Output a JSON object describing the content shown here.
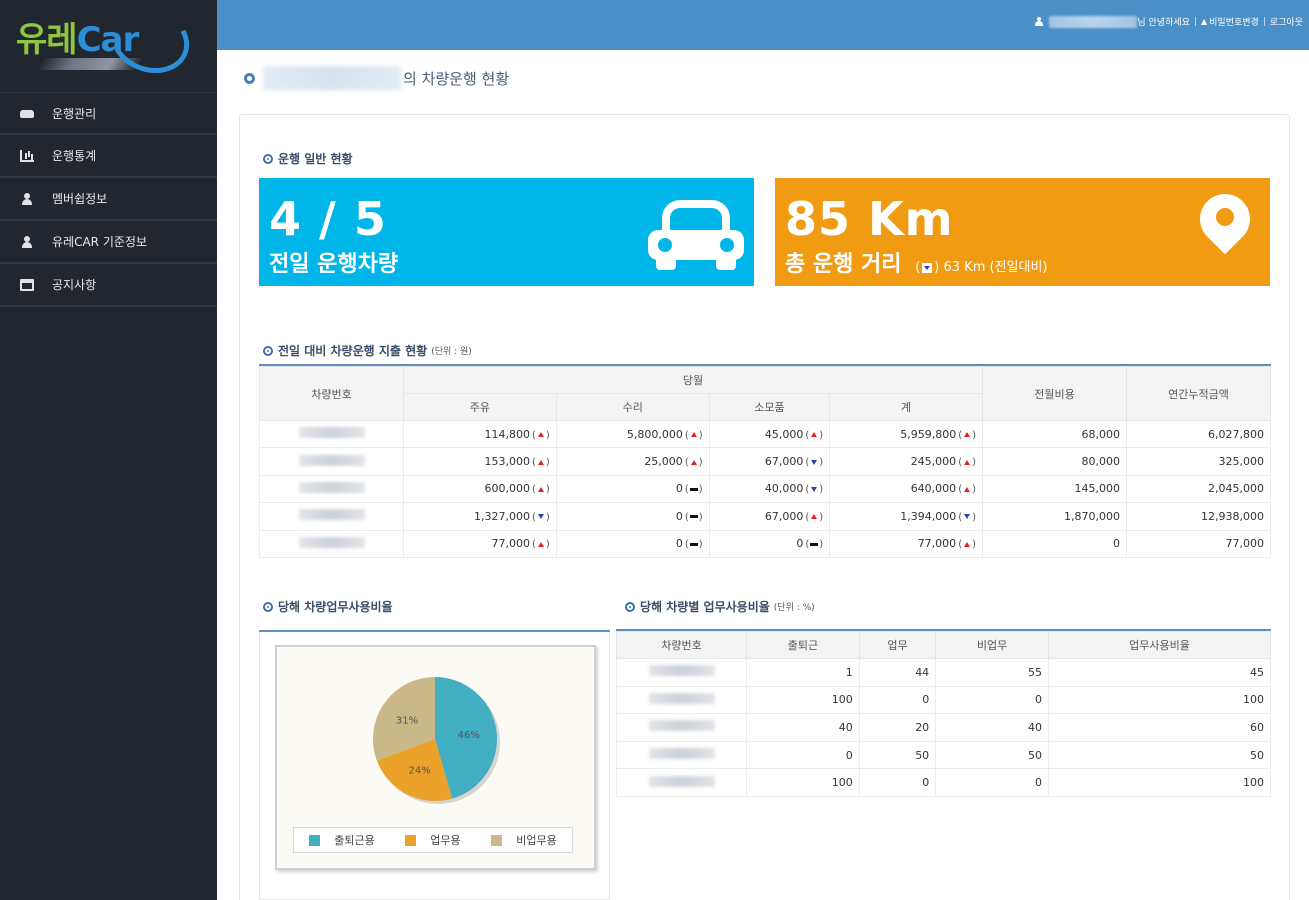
{
  "app": {
    "logo": {
      "part1": "유레",
      "part2": "Car"
    }
  },
  "sidebar": {
    "items": [
      {
        "label": "운행관리",
        "icon": "car-icon"
      },
      {
        "label": "운행통계",
        "icon": "chart-icon"
      },
      {
        "label": "멤버쉽정보",
        "icon": "user-icon"
      },
      {
        "label": "유레CAR 기준정보",
        "icon": "user-icon"
      },
      {
        "label": "공지사항",
        "icon": "calendar-icon"
      }
    ]
  },
  "topbar": {
    "greeting": "님 안녕하세요",
    "change_password": "비밀번호변경",
    "logout": "로그아웃",
    "separator": "|"
  },
  "page": {
    "title_suffix": "의 차량운행 현황"
  },
  "section_general": {
    "title": "운행 일반 현황",
    "cards": {
      "vehicles": {
        "value": "4 / 5",
        "label": "전일 운행차량",
        "color": "#00b5e8"
      },
      "distance": {
        "value": "85 Km",
        "label": "총 운행 거리",
        "delta_prefix": "(",
        "delta": "63 Km (전일대비)",
        "color": "#f19b13"
      }
    }
  },
  "section_expense": {
    "title": "전일 대비 차량운행 지출 현황",
    "unit": "(단위 : 원)",
    "headers": {
      "vehicle_no": "차량번호",
      "group_today": "당월",
      "fuel": "주유",
      "repair": "수리",
      "consumables": "소모품",
      "total": "계",
      "prev_month": "전월비용",
      "annual": "연간누적금액"
    },
    "rows": [
      {
        "fuel": "114,800",
        "fuel_t": "up",
        "repair": "5,800,000",
        "repair_t": "up",
        "cons": "45,000",
        "cons_t": "up",
        "total": "5,959,800",
        "total_t": "up",
        "prev": "68,000",
        "annual": "6,027,800"
      },
      {
        "fuel": "153,000",
        "fuel_t": "up",
        "repair": "25,000",
        "repair_t": "up",
        "cons": "67,000",
        "cons_t": "down",
        "total": "245,000",
        "total_t": "up",
        "prev": "80,000",
        "annual": "325,000"
      },
      {
        "fuel": "600,000",
        "fuel_t": "up",
        "repair": "0",
        "repair_t": "flat",
        "cons": "40,000",
        "cons_t": "down",
        "total": "640,000",
        "total_t": "up",
        "prev": "145,000",
        "annual": "2,045,000"
      },
      {
        "fuel": "1,327,000",
        "fuel_t": "down",
        "repair": "0",
        "repair_t": "flat",
        "cons": "67,000",
        "cons_t": "up",
        "total": "1,394,000",
        "total_t": "down",
        "prev": "1,870,000",
        "annual": "12,938,000"
      },
      {
        "fuel": "77,000",
        "fuel_t": "up",
        "repair": "0",
        "repair_t": "flat",
        "cons": "0",
        "cons_t": "flat",
        "total": "77,000",
        "total_t": "up",
        "prev": "0",
        "annual": "77,000"
      }
    ]
  },
  "section_pie": {
    "title": "당해 차량업무사용비율",
    "legend": [
      {
        "label": "출퇴근용",
        "color": "#42aec2"
      },
      {
        "label": "업무용",
        "color": "#eba12a"
      },
      {
        "label": "비업무용",
        "color": "#cbb889"
      }
    ]
  },
  "chart_data": {
    "type": "pie",
    "categories": [
      "출퇴근용",
      "업무용",
      "비업무용"
    ],
    "values": [
      46,
      24,
      31
    ],
    "labels": [
      "46%",
      "24%",
      "31%"
    ],
    "colors": [
      "#42aec2",
      "#eba12a",
      "#cbb889"
    ],
    "legend_position": "bottom"
  },
  "section_ratio": {
    "title": "당해 차량별 업무사용비율",
    "unit": "(단위 : %)",
    "headers": [
      "차량번호",
      "출퇴근",
      "업무",
      "비업무",
      "업무사용비율"
    ],
    "rows": [
      [
        "1",
        "44",
        "55",
        "45"
      ],
      [
        "100",
        "0",
        "0",
        "100"
      ],
      [
        "40",
        "20",
        "40",
        "60"
      ],
      [
        "0",
        "50",
        "50",
        "50"
      ],
      [
        "100",
        "0",
        "0",
        "100"
      ]
    ]
  }
}
